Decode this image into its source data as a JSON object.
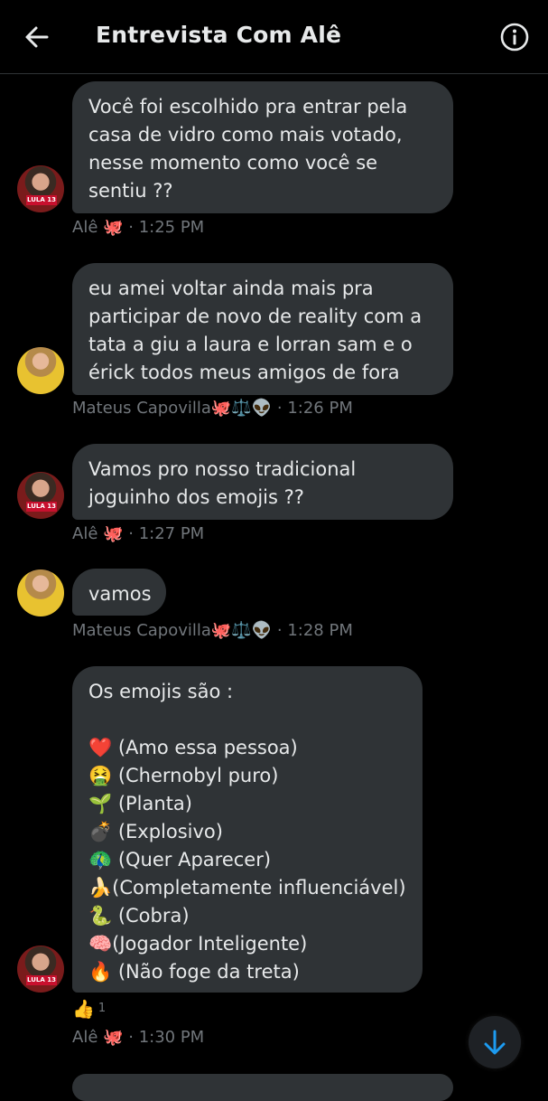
{
  "header": {
    "title": "Entrevista Com Alê"
  },
  "messages": [
    {
      "sender": "Alê",
      "text": "Você foi escolhido pra entrar pela\ncasa de vidro como mais votado,\nnesse momento como você se\nsentiu ??",
      "meta": "Alê 🐙 · 1:25 PM"
    },
    {
      "sender": "Mateus Capovilla",
      "text": "eu amei voltar ainda mais pra\nparticipar de novo de reality com a\ntata a giu a laura e lorran sam e o\nérick todos meus amigos de fora",
      "meta": "Mateus Capovilla🐙⚖️👽 · 1:26 PM"
    },
    {
      "sender": "Alê",
      "text": "Vamos pro nosso tradicional\njoguinho dos emojis ??",
      "meta": "Alê 🐙 · 1:27 PM"
    },
    {
      "sender": "Mateus Capovilla",
      "text": "vamos",
      "meta": "Mateus Capovilla🐙⚖️👽 · 1:28 PM"
    },
    {
      "sender": "Alê",
      "text": "Os emojis são :\n\n❤️ (Amo essa pessoa)\n🤮 (Chernobyl puro)\n🌱 (Planta)\n💣 (Explosivo)\n🦚 (Quer Aparecer)\n🍌(Completamente influenciável)\n🐍 (Cobra)\n🧠(Jogador Inteligente)\n🔥 (Não foge da treta)",
      "meta": "Alê 🐙 · 1:30 PM",
      "reaction": "👍",
      "reaction_count": "1"
    }
  ],
  "avatars": {
    "ale_badge": "LULA 13"
  },
  "colors": {
    "background": "#000000",
    "bubble": "#2f3336",
    "meta": "#71767b",
    "accent": "#1d9bf0"
  },
  "icons": {
    "back": "arrow-left-icon",
    "info": "info-icon",
    "scroll": "arrow-down-icon"
  }
}
